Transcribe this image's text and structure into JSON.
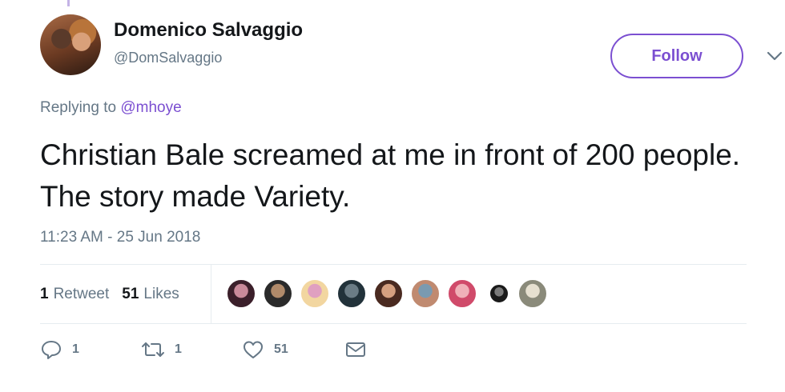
{
  "author": {
    "display_name": "Domenico Salvaggio",
    "handle": "@DomSalvaggio"
  },
  "follow_label": "Follow",
  "reply": {
    "prefix": "Replying to",
    "mention": "@mhoye"
  },
  "tweet": {
    "text": "Christian Bale screamed at me in front of 200 people. The story made Variety.",
    "timestamp": "11:23 AM - 25 Jun 2018"
  },
  "stats": {
    "retweet_count": "1",
    "retweet_label": "Retweet",
    "like_count": "51",
    "like_label": "Likes"
  },
  "likers": [
    {
      "colors": [
        "#3b1f2a",
        "#c98a9a"
      ]
    },
    {
      "colors": [
        "#2a2a2a",
        "#b08a6a"
      ]
    },
    {
      "colors": [
        "#f2d6a0",
        "#e0a0c0"
      ],
      "small": false
    },
    {
      "colors": [
        "#22323a",
        "#6b7c85"
      ]
    },
    {
      "colors": [
        "#4a2a20",
        "#d6a080"
      ]
    },
    {
      "colors": [
        "#c08a70",
        "#7a9ab0"
      ]
    },
    {
      "colors": [
        "#d04a6a",
        "#f0b0b8"
      ]
    },
    {
      "colors": [
        "#1a1a1a",
        "#7a7a7a"
      ],
      "small": true
    },
    {
      "colors": [
        "#8a8a7a",
        "#e6e0d0"
      ]
    }
  ],
  "actions": {
    "reply_count": "1",
    "retweet_count": "1",
    "like_count": "51"
  },
  "colors": {
    "accent": "#7b4fd1",
    "secondary_text": "#657786",
    "divider": "#e6ecf0"
  }
}
